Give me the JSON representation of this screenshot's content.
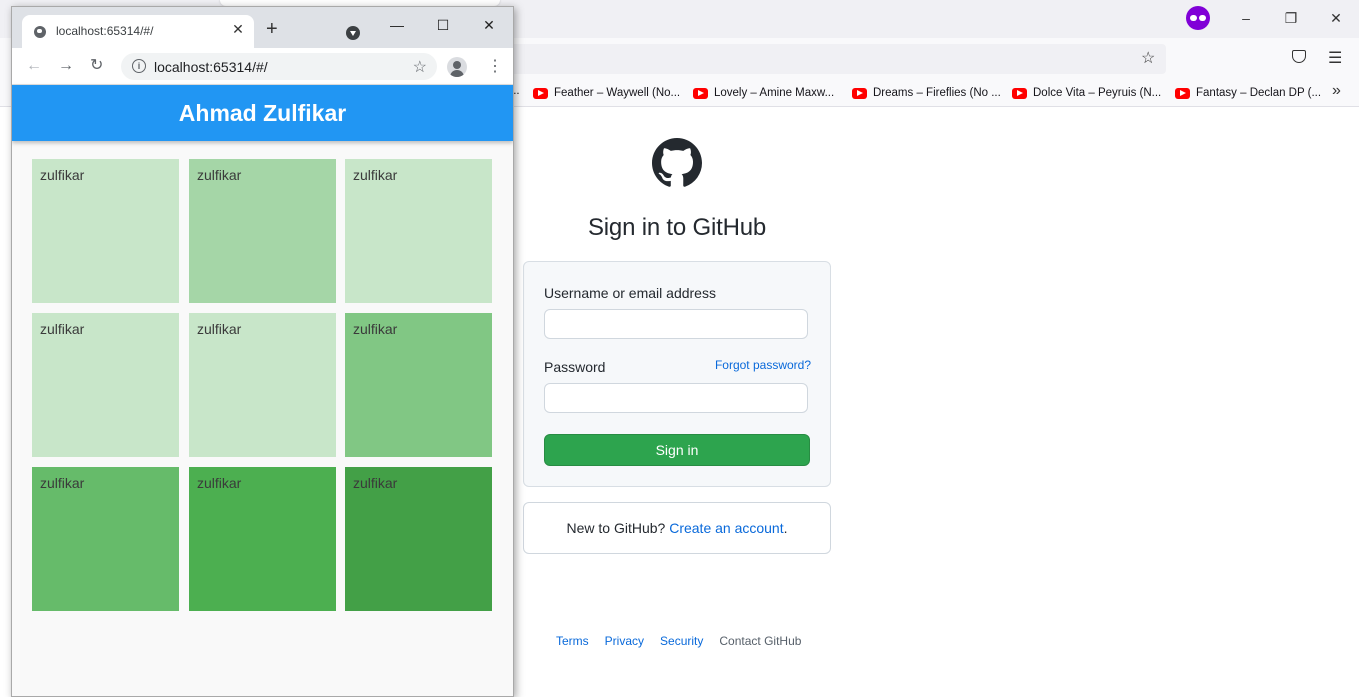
{
  "background_browser": {
    "bookmarks": [
      "Feather – Waywell (No...",
      "Lovely – Amine Maxw...",
      "Dreams – Fireflies (No ...",
      "Dolce Vita – Peyruis (N...",
      "Fantasy – Declan DP (..."
    ],
    "bookmarks_overflow": "»",
    "bookmarks_ellipsis": "...",
    "icons": {
      "private_browsing": "private-browsing-mask-icon",
      "minimize": "–",
      "restore": "❐",
      "close": "✕",
      "star": "☆",
      "pocket": "pocket-icon",
      "menu": "☰"
    }
  },
  "github": {
    "title": "Sign in to GitHub",
    "username_label": "Username or email address",
    "password_label": "Password",
    "forgot_password": "Forgot password?",
    "sign_in_button": "Sign in",
    "new_text": "New to GitHub?",
    "create_account": "Create an account",
    "create_suffix": ".",
    "footer": {
      "terms": "Terms",
      "privacy": "Privacy",
      "security": "Security",
      "contact": "Contact GitHub"
    },
    "colors": {
      "primary_button": "#2da44e",
      "link": "#0969da"
    }
  },
  "chrome_window": {
    "tab_title": "localhost:65314/#/",
    "tab_close": "✕",
    "new_tab": "+",
    "window_controls": {
      "minimize": "—",
      "maximize": "☐",
      "close": "✕"
    },
    "toolbar": {
      "back": "←",
      "forward": "→",
      "reload": "↻",
      "info": "i",
      "star": "☆",
      "menu": "⋮"
    },
    "url": "localhost:65314/#/"
  },
  "app": {
    "title": "Ahmad Zulfikar",
    "app_bar_color": "#2196f3",
    "tiles": [
      {
        "label": "zulfikar",
        "color": "#c8e6c9"
      },
      {
        "label": "zulfikar",
        "color": "#a5d6a7"
      },
      {
        "label": "zulfikar",
        "color": "#c8e6c9"
      },
      {
        "label": "zulfikar",
        "color": "#c8e6c9"
      },
      {
        "label": "zulfikar",
        "color": "#c8e6c9"
      },
      {
        "label": "zulfikar",
        "color": "#81c784"
      },
      {
        "label": "zulfikar",
        "color": "#66bb6a"
      },
      {
        "label": "zulfikar",
        "color": "#4caf50"
      },
      {
        "label": "zulfikar",
        "color": "#43a047"
      }
    ]
  }
}
